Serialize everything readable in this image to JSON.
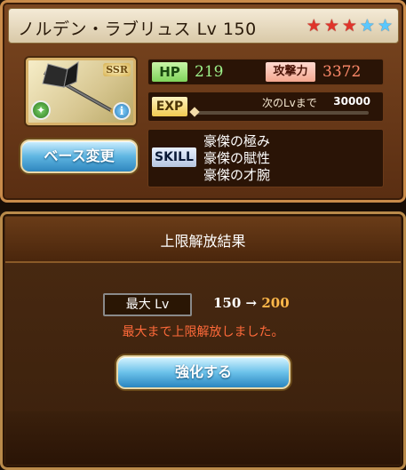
{
  "weapon": {
    "name": "ノルデン・ラブリュス",
    "level_text": "Lv 150",
    "rarity": "SSR",
    "stars": [
      {
        "color": "red"
      },
      {
        "color": "red"
      },
      {
        "color": "red"
      },
      {
        "color": "blue"
      },
      {
        "color": "blue"
      }
    ],
    "element_icon": "wind-element-icon",
    "info_label": "i"
  },
  "stats": {
    "hp_label": "HP",
    "hp_value": "219",
    "atk_label": "攻撃力",
    "atk_value": "3372",
    "exp_label": "EXP",
    "exp_next_label": "次のLvまで",
    "exp_next_value": "30000",
    "exp_progress": 0
  },
  "skill": {
    "label": "SKILL",
    "items": [
      "豪傑の極み",
      "豪傑の賦性",
      "豪傑の才腕"
    ]
  },
  "buttons": {
    "base_change": "ベース変更",
    "enhance": "強化する"
  },
  "dialog": {
    "title": "上限解放結果",
    "max_lv_label": "最大 Lv",
    "lv_from": "150",
    "lv_arrow": "→",
    "lv_to": "200",
    "notice": "最大まで上限解放しました。"
  },
  "colors": {
    "star_red": "#e0342a",
    "star_blue": "#59c8ff",
    "hp_value": "#9ef28a",
    "atk_value": "#ff8a6a",
    "notice": "#ff6a3a",
    "lv_to": "#ffb84a"
  }
}
